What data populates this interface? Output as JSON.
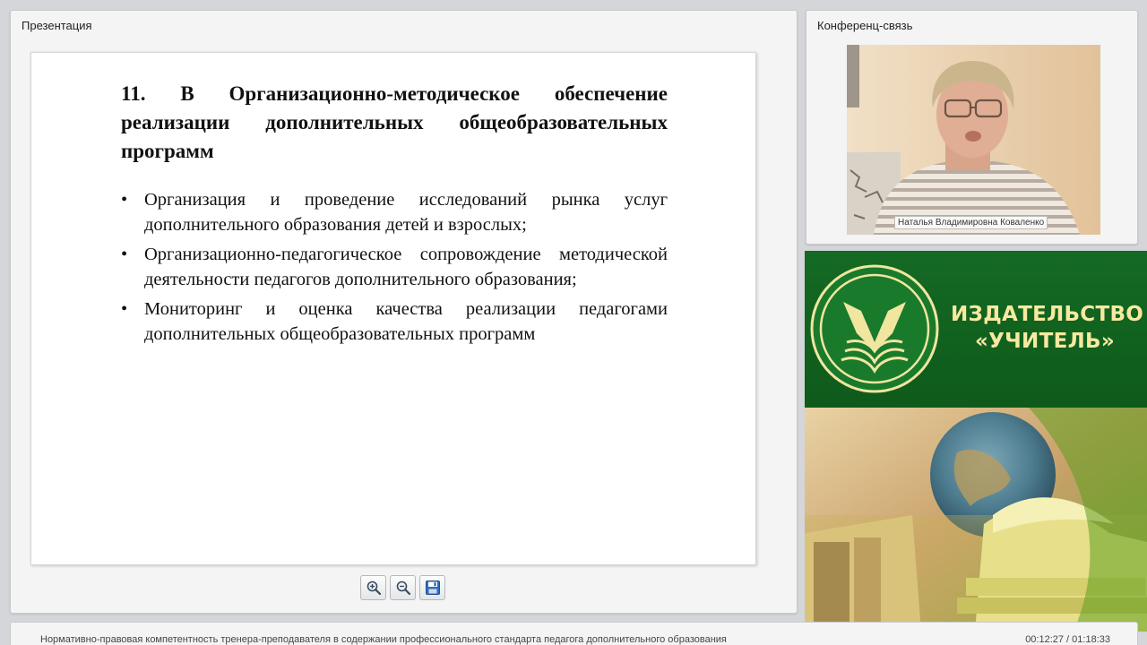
{
  "presentation": {
    "title": "Презентация",
    "slide": {
      "heading": "11. В Организационно-методическое обеспечение реализации дополнительных общеобразовательных программ",
      "bullets": [
        "Организация и проведение исследований рынка услуг дополнительного образования детей и взрослых;",
        "Организационно-педагогическое сопровождение методической деятельности педагогов дополнительного образования;",
        "Мониторинг и оценка качества реализации педагогами дополнительных общеобразовательных программ"
      ]
    },
    "toolbar": {
      "zoom_in_icon": "zoom-in-icon",
      "zoom_out_icon": "zoom-out-icon",
      "save_icon": "floppy-save-icon"
    }
  },
  "conference": {
    "title": "Конференц-связь",
    "speaker_name": "Наталья Владимировна Коваленко"
  },
  "ad": {
    "line1": "ИЗДАТЕЛЬСТВО",
    "line2": "«УЧИТЕЛЬ»",
    "colors": {
      "green": "#146a24",
      "gold": "#f7e9a0"
    }
  },
  "footer": {
    "title": "Нормативно-правовая компетентность тренера-преподавателя в содержании профессионального стандарта педагога дополнительного образования",
    "time": "00:12:27 / 01:18:33"
  }
}
